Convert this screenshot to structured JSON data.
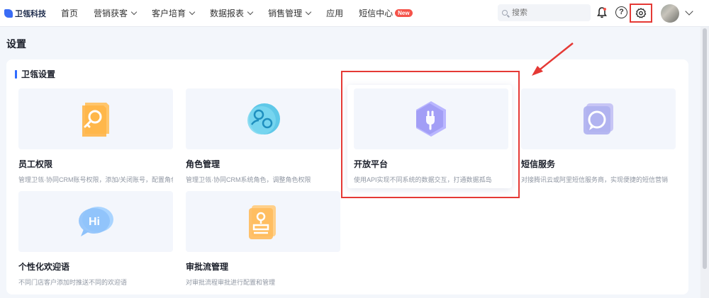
{
  "app": {
    "logo_text": "卫瓴科技"
  },
  "nav": {
    "items": [
      {
        "label": "首页",
        "dropdown": false
      },
      {
        "label": "营销获客",
        "dropdown": true
      },
      {
        "label": "客户培育",
        "dropdown": true
      },
      {
        "label": "数据报表",
        "dropdown": true
      },
      {
        "label": "销售管理",
        "dropdown": true
      },
      {
        "label": "应用",
        "dropdown": false
      },
      {
        "label": "短信中心",
        "dropdown": false,
        "badge": "New"
      }
    ]
  },
  "search": {
    "placeholder": "搜索"
  },
  "page": {
    "title": "设置"
  },
  "section": {
    "title": "卫瓴设置"
  },
  "cards": [
    {
      "title": "员工权限",
      "desc": "管理卫瓴·协同CRM账号权限，添加/关闭账号，配置角色",
      "icon": "key-icon"
    },
    {
      "title": "角色管理",
      "desc": "管理卫瓴·协同CRM系统角色，调整角色权限",
      "icon": "users-icon"
    },
    {
      "title": "开放平台",
      "desc": "使用API实现不同系统的数据交互，打通数据孤岛",
      "icon": "plug-icon"
    },
    {
      "title": "短信服务",
      "desc": "对接腾讯云或阿里短信服务商，实现便捷的短信营销",
      "icon": "message-icon"
    },
    {
      "title": "个性化欢迎语",
      "desc": "不同门店客户添加时推送不同的欢迎语",
      "icon": "chat-hi-icon"
    },
    {
      "title": "审批流管理",
      "desc": "对审批流程审批进行配置和管理",
      "icon": "stamp-icon"
    }
  ],
  "colors": {
    "accent": "#2f6bff",
    "highlight": "#e53935",
    "badge": "#f5534a"
  }
}
